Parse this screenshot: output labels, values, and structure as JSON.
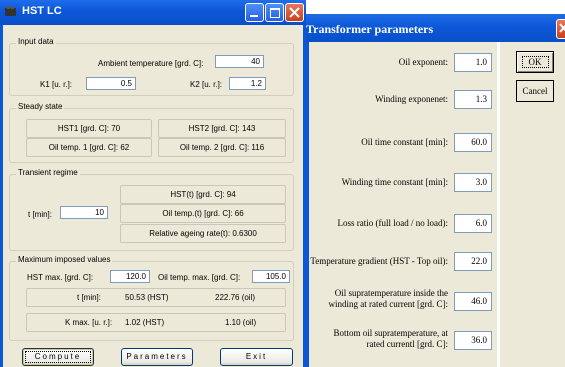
{
  "hst": {
    "title": "HST LC",
    "input": {
      "caption": "Input data",
      "ambient_label": "Ambient temperature [grd. C]:",
      "ambient_value": "40",
      "k1_label": "K1 [u. r.]:",
      "k1_value": "0.5",
      "k2_label": "K2 [u. r.]:",
      "k2_value": "1.2"
    },
    "steady": {
      "caption": "Steady state",
      "hst1": "HST1 [grd. C]: 70",
      "hst2": "HST2 [grd. C]: 143",
      "oil1": "Oil temp. 1 [grd. C]: 62",
      "oil2": "Oil temp. 2 [grd. C]: 116"
    },
    "transient": {
      "caption": "Transient regime",
      "t_label": "t [min]:",
      "t_value": "10",
      "hst_t": "HST(t) [grd. C]: 94",
      "oil_t": "Oil temp.(t) [grd. C]: 66",
      "ageing": "Relative ageing rate(t): 0.6300"
    },
    "maximum": {
      "caption": "Maximum imposed values",
      "hst_max_label": "HST max. [grd. C]:",
      "hst_max_value": "120.0",
      "oil_max_label": "Oil temp. max. [grd. C]:",
      "oil_max_value": "105.0",
      "t_label": "t [min]:",
      "t_hst": "50.53 (HST)",
      "t_oil": "222.76 (oil)",
      "k_label": "K max. [u. r.]:",
      "k_hst": "1.02 (HST)",
      "k_oil": "1.10 (oil)"
    },
    "buttons": {
      "compute": "Compute",
      "parameters": "Parameters",
      "exit": "Exit"
    }
  },
  "params": {
    "title": "Transformer parameters",
    "fields": [
      {
        "label": "Oil exponent:",
        "value": "1.0"
      },
      {
        "label": "Winding exponenet:",
        "value": "1.3"
      },
      {
        "label": "Oil time constant [min]:",
        "value": "60.0"
      },
      {
        "label": "Winding time constant [min]:",
        "value": "3.0"
      },
      {
        "label": "Loss ratio (full load / no load):",
        "value": "6.0"
      },
      {
        "label": "Temperature gradient (HST - Top oil):",
        "value": "22.0"
      },
      {
        "label": "Oil supratemperature inside the winding at rated current [grd. C]:",
        "value": "46.0"
      },
      {
        "label": "Bottom oil supratemperature, at rated currentl [grd. C]:",
        "value": "36.0"
      }
    ],
    "ok": "OK",
    "cancel": "Cancel"
  },
  "colors": {
    "titlebar": "#0c57d8",
    "face": "#ece9d8",
    "close": "#d9502b"
  }
}
